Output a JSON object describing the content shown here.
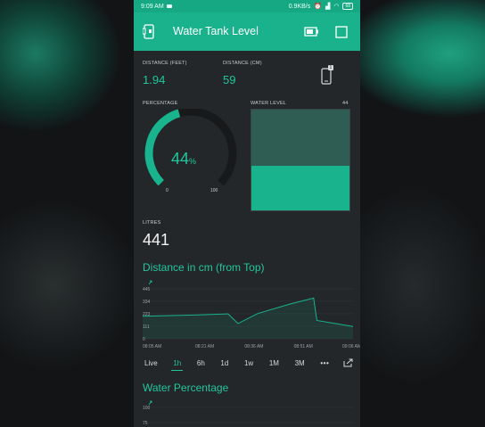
{
  "status": {
    "time": "9:09 AM",
    "speed": "0.9KB/s",
    "battery": "68"
  },
  "app": {
    "title": "Water Tank Level"
  },
  "distance_feet": {
    "label": "DISTANCE (FEET)",
    "value": "1.94"
  },
  "distance_cm": {
    "label": "DISTANCE (CM)",
    "value": "59"
  },
  "notification_badge": "1",
  "percentage": {
    "label": "PERCENTAGE",
    "value": "44",
    "unit": "%",
    "min": "0",
    "max": "100",
    "fraction": 0.44
  },
  "water_level": {
    "label": "WATER LEVEL",
    "value": "44",
    "fraction": 0.44
  },
  "litres": {
    "label": "LITRES",
    "value": "441"
  },
  "chart1": {
    "title": "Distance in cm (from Top)"
  },
  "chart2": {
    "title": "Water Percentage"
  },
  "tabs": [
    "Live",
    "1h",
    "6h",
    "1d",
    "1w",
    "1M",
    "3M"
  ],
  "colors": {
    "accent": "#1ab28c",
    "panel": "#24272a",
    "fill": "#19b48e",
    "empty": "#2f5d54"
  },
  "chart_data": [
    {
      "type": "area",
      "title": "Distance in cm (from Top)",
      "x": [
        "08:05 AM",
        "08:21 AM",
        "08:36 AM",
        "08:51 AM",
        "09:06 AM"
      ],
      "y_ticks": [
        "0",
        "111",
        "223",
        "334",
        "445"
      ],
      "ylim": [
        0,
        445
      ],
      "points": [
        [
          "08:05 AM",
          200
        ],
        [
          "08:21 AM",
          211
        ],
        [
          "08:31 AM",
          222
        ],
        [
          "08:34 AM",
          136
        ],
        [
          "08:40 AM",
          225
        ],
        [
          "08:50 AM",
          311
        ],
        [
          "08:57 AM",
          362
        ],
        [
          "08:58 AM",
          163
        ],
        [
          "09:09 AM",
          110
        ]
      ]
    },
    {
      "type": "area",
      "title": "Water Percentage",
      "y_ticks": [
        "75",
        "100"
      ],
      "ylim": [
        0,
        100
      ]
    }
  ]
}
